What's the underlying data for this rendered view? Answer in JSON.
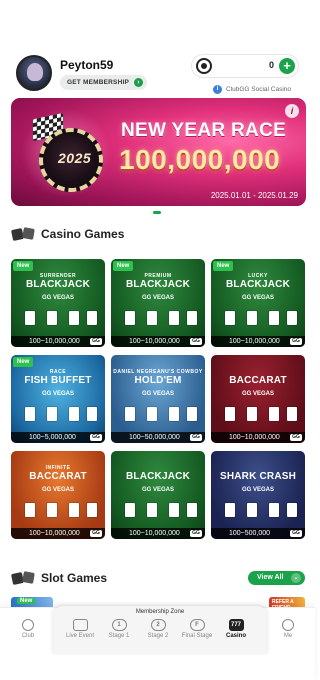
{
  "profile": {
    "username": "Peyton59",
    "membership_label": "GET MEMBERSHIP"
  },
  "balance": {
    "value": "0",
    "note": "ClubGG Social Casino"
  },
  "banner": {
    "chip_text": "2025",
    "title": "NEW YEAR RACE",
    "amount": "100,000,000",
    "dates": "2025.01.01 - 2025.01.29"
  },
  "casino_section": {
    "title": "Casino Games"
  },
  "games": [
    {
      "new": "New",
      "sub": "SURRENDER",
      "name": "BLACKJACK",
      "brand": "GG VEGAS",
      "range": "100~10,000,000",
      "gg": "GG",
      "color": "#1c6a2c"
    },
    {
      "new": "New",
      "sub": "PREMIUM",
      "name": "BLACKJACK",
      "brand": "GG VEGAS",
      "range": "100~10,000,000",
      "gg": "GG",
      "color": "#1c6a2c"
    },
    {
      "new": "New",
      "sub": "LUCKY",
      "name": "BLACKJACK",
      "brand": "GG VEGAS",
      "range": "100~10,000,000",
      "gg": "GG",
      "color": "#1c6a2c"
    },
    {
      "new": "New",
      "sub": "RACE",
      "name": "FISH BUFFET",
      "brand": "GG VEGAS",
      "range": "100~5,000,000",
      "gg": "GG",
      "color": "#1d6aa3"
    },
    {
      "new": "",
      "sub": "DANIEL NEGREANU'S COWBOY",
      "name": "HOLD'EM",
      "brand": "GG VEGAS",
      "range": "100~50,000,000",
      "gg": "GG",
      "color": "#2b5d8f"
    },
    {
      "new": "",
      "sub": "",
      "name": "BACCARAT",
      "brand": "GG VEGAS",
      "range": "100~10,000,000",
      "gg": "GG",
      "color": "#6a1220"
    },
    {
      "new": "",
      "sub": "INFINITE",
      "name": "BACCARAT",
      "brand": "GG VEGAS",
      "range": "100~10,000,000",
      "gg": "GG",
      "color": "#a53a14"
    },
    {
      "new": "",
      "sub": "",
      "name": "BLACKJACK",
      "brand": "GG VEGAS",
      "range": "100~10,000,000",
      "gg": "GG",
      "color": "#145a22"
    },
    {
      "new": "",
      "sub": "",
      "name": "SHARK CRASH",
      "brand": "GG VEGAS",
      "range": "100~500,000",
      "gg": "GG",
      "color": "#1b2352"
    }
  ],
  "slot_section": {
    "title": "Slot Games",
    "view_all": "View All",
    "new_badge": "New",
    "refer_badge": "REFER A FRIEND"
  },
  "tabbar": {
    "zone_label": "Membership Zone",
    "tabs": [
      {
        "label": "Club",
        "icon": "club-icon"
      },
      {
        "label": "Live Event",
        "icon": "calendar-icon"
      },
      {
        "label": "Stage 1",
        "icon": "stage-1-icon",
        "glyph": "1"
      },
      {
        "label": "Stage 2",
        "icon": "stage-2-icon",
        "glyph": "2"
      },
      {
        "label": "Final Stage",
        "icon": "final-stage-icon",
        "glyph": "F"
      },
      {
        "label": "Casino",
        "icon": "casino-icon",
        "glyph": "777"
      },
      {
        "label": "Me",
        "icon": "person-icon"
      }
    ]
  }
}
